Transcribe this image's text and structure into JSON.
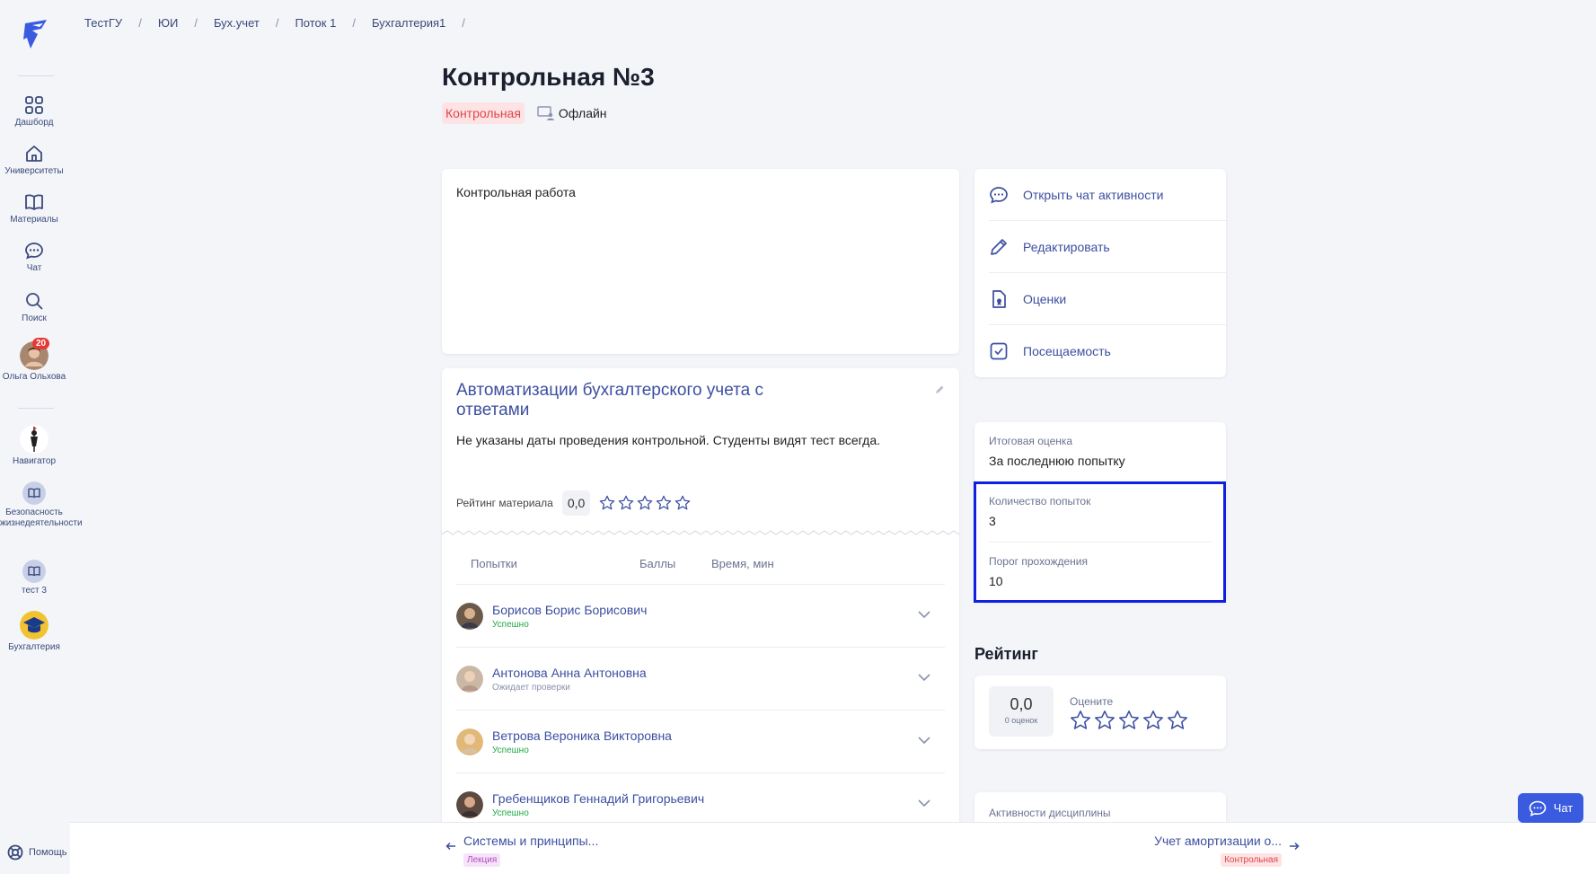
{
  "breadcrumbs": [
    "ТестГУ",
    "ЮИ",
    "Бух.учет",
    "Поток 1",
    "Бухгалтерия1"
  ],
  "breadcrumb_sep": "/",
  "sidebar": {
    "items": [
      {
        "label": "Дашборд",
        "icon": "dashboard-icon"
      },
      {
        "label": "Университеты",
        "icon": "university-icon"
      },
      {
        "label": "Материалы",
        "icon": "book-icon"
      },
      {
        "label": "Чат",
        "icon": "chat-icon"
      },
      {
        "label": "Поиск",
        "icon": "search-icon"
      }
    ],
    "user": {
      "name": "Ольга Ольхова",
      "badge": "20"
    },
    "courses": [
      {
        "label": "Навигатор",
        "icon": "navigator-icon"
      },
      {
        "label": "Безопасность жизнедеятельности",
        "icon": "course-book-icon"
      },
      {
        "label": "тест 3",
        "icon": "course-book-icon"
      },
      {
        "label": "Бухгалтерия",
        "icon": "graduation-icon"
      }
    ],
    "help": "Помощь"
  },
  "page": {
    "title": "Контрольная №3",
    "type_tag": "Контрольная",
    "mode": "Офлайн"
  },
  "description": "Контрольная работа",
  "test": {
    "title": "Автоматизации бухгалтерского учета с ответами",
    "note": "Не указаны даты проведения контрольной. Студенты видят тест всегда.",
    "rating_label": "Рейтинг материала",
    "rating_value": "0,0",
    "stars": 0
  },
  "attempts_table": {
    "headers": [
      "Попытки",
      "Баллы",
      "Время, мин"
    ],
    "rows": [
      {
        "name": "Борисов Борис Борисович",
        "status": "Успешно",
        "status_type": "ok"
      },
      {
        "name": "Антонова Анна Антоновна",
        "status": "Ожидает проверки",
        "status_type": "wait"
      },
      {
        "name": "Ветрова Вероника Викторовна",
        "status": "Успешно",
        "status_type": "ok"
      },
      {
        "name": "Гребенщиков Геннадий Григорьевич",
        "status": "Успешно",
        "status_type": "ok"
      }
    ]
  },
  "actions": [
    {
      "label": "Открыть чат активности",
      "icon": "chat-bubble-icon"
    },
    {
      "label": "Редактировать",
      "icon": "pencil-icon"
    },
    {
      "label": "Оценки",
      "icon": "grades-doc-icon"
    },
    {
      "label": "Посещаемость",
      "icon": "checkbox-icon"
    }
  ],
  "info": {
    "final_grade_label": "Итоговая оценка",
    "final_grade_value": "За последнюю попытку",
    "attempts_label": "Количество попыток",
    "attempts_value": "3",
    "threshold_label": "Порог прохождения",
    "threshold_value": "10"
  },
  "rating": {
    "title": "Рейтинг",
    "value": "0,0",
    "count": "0 оценок",
    "rate_label": "Оцените"
  },
  "discipline_activities": "Активности дисциплины",
  "bottom_nav": {
    "prev": {
      "title": "Системы и принципы...",
      "tag": "Лекция"
    },
    "next": {
      "title": "Учет амортизации о...",
      "tag": "Контрольная"
    }
  },
  "chat_button": "Чат",
  "colors": {
    "accent": "#3c4fa0",
    "primary_button": "#3a5be0",
    "danger_tag": "#e0454d",
    "success": "#22a845",
    "highlight": "#1020e0"
  }
}
